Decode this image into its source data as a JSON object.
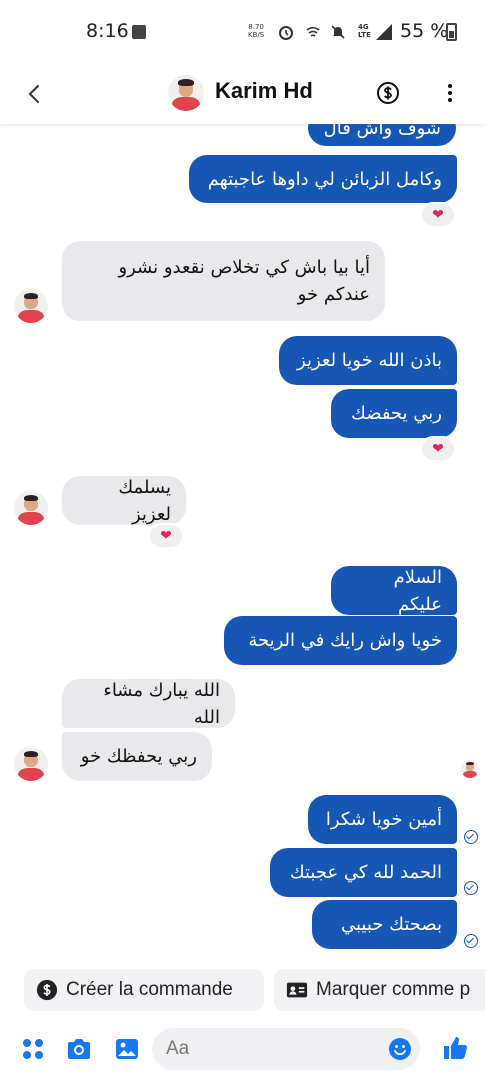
{
  "status_bar": {
    "time": "8:16",
    "net_speed": "8.70",
    "net_speed_unit": "KB/S",
    "network_type": "4G",
    "network_sub": "LTE",
    "battery": "55 %"
  },
  "header": {
    "contact_name": "Karim Hd"
  },
  "messages": [
    {
      "text": "شوف واش قال"
    },
    {
      "text": "وكامل الزبائن لي داوها عاجبتهم"
    },
    {
      "text": "أيا بيا باش كي تخلاص نقعدو نشرو عندكم خو"
    },
    {
      "text": "باذن الله خويا لعزيز"
    },
    {
      "text": "ربي يحفضك"
    },
    {
      "text": "يسلمك لعزيز"
    },
    {
      "text": "السلام عليكم"
    },
    {
      "text": "خويا واش رايك في الريحة"
    },
    {
      "text": "الله يبارك مشاء الله"
    },
    {
      "text": "ربي يحفظك خو"
    },
    {
      "text": "أمين خويا شكرا"
    },
    {
      "text": "الحمد لله كي عجبتك"
    },
    {
      "text": "بصحتك حبيبي"
    }
  ],
  "reaction_emoji": "heart",
  "quick_actions": {
    "create_order": "Créer la commande",
    "mark_as": "Marquer comme p"
  },
  "composer": {
    "placeholder": "Aa"
  },
  "colors": {
    "outgoing_bubble": "#1656b4",
    "incoming_bubble": "#e9e9eb",
    "accent": "#1877f2",
    "heart": "#e0245e"
  },
  "icons": [
    "back-arrow-icon",
    "dollar-icon",
    "more-vertical-icon",
    "grid-menu-icon",
    "camera-icon",
    "gallery-icon",
    "emoji-icon",
    "thumbs-up-icon",
    "heart-icon",
    "seen-check-icon"
  ]
}
